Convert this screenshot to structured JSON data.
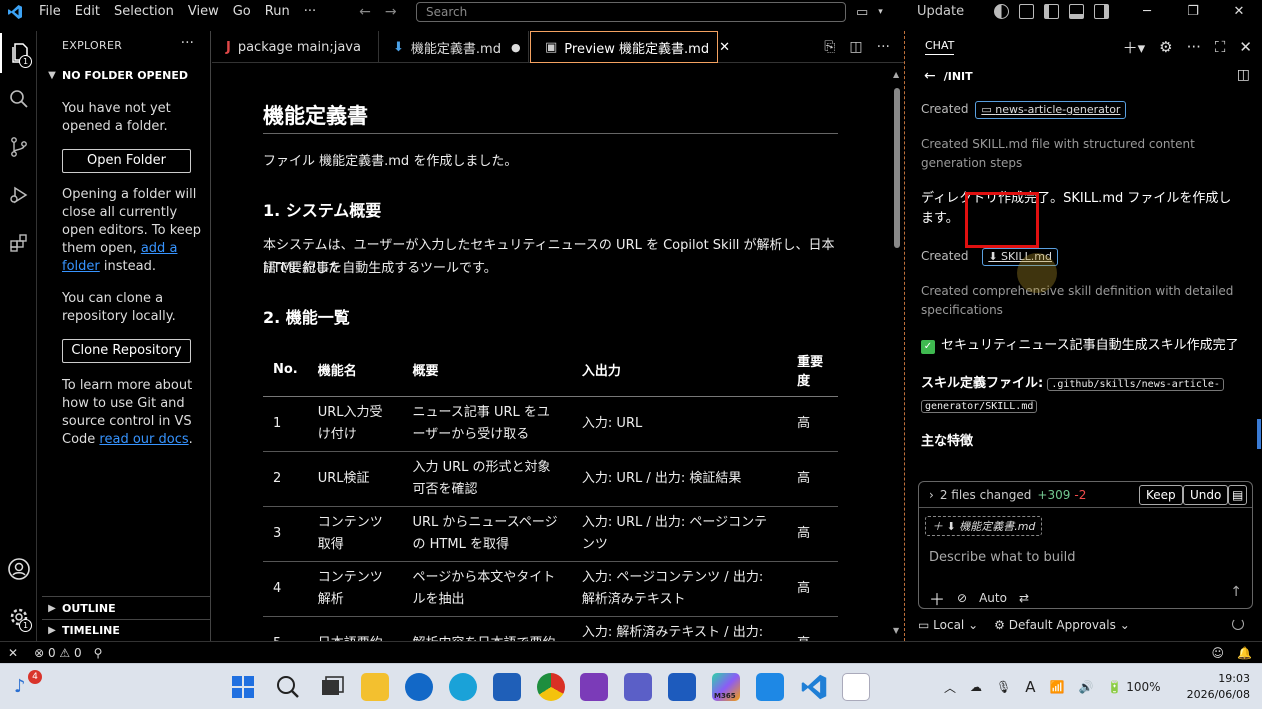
{
  "titlebar": {
    "menu": [
      "File",
      "Edit",
      "Selection",
      "View",
      "Go",
      "Run",
      "···"
    ],
    "search_placeholder": "Search",
    "update_label": "Update"
  },
  "sidebar": {
    "title": "EXPLORER",
    "section": "NO FOLDER OPENED",
    "msg1": "You have not yet opened a folder.",
    "open_folder": "Open Folder",
    "msg2_pre": "Opening a folder will close all currently open editors. To keep them open, ",
    "msg2_link": "add a folder",
    "msg2_post": " instead.",
    "msg3": "You can clone a repository locally.",
    "clone_repo": "Clone Repository",
    "msg4_pre": "To learn more about how to use Git and source control in VS Code ",
    "msg4_link": "read our docs",
    "msg4_post": ".",
    "outline": "OUTLINE",
    "timeline": "TIMELINE"
  },
  "tabs": [
    {
      "label": "package main;java",
      "icon": "J"
    },
    {
      "label": "機能定義書.md",
      "icon": "⬇",
      "dirty": "●"
    },
    {
      "label": "Preview 機能定義書.md",
      "icon": "▣",
      "close": "✕"
    }
  ],
  "doc": {
    "h1": "機能定義書",
    "intro": "ファイル 機能定義書.md を作成しました。",
    "h2_1": "1. システム概要",
    "p1_line1": "本システムは、ユーザーが入力したセキュリティニュースの URL を Copilot Skill が解析し、日本語で要約した",
    "p1_line2": "HTML 記事を自動生成するツールです。",
    "h2_2": "2. 機能一覧",
    "table_headers": [
      "No.",
      "機能名",
      "概要",
      "入出力",
      "重要度"
    ],
    "table_rows": [
      [
        "1",
        "URL入力受け付け",
        "ニュース記事 URL をユーザーから受け取る",
        "入力: URL",
        "高"
      ],
      [
        "2",
        "URL検証",
        "入力 URL の形式と対象可否を確認",
        "入力: URL / 出力: 検証結果",
        "高"
      ],
      [
        "3",
        "コンテンツ取得",
        "URL からニュースページの HTML を取得",
        "入力: URL / 出力: ページコンテンツ",
        "高"
      ],
      [
        "4",
        "コンテンツ解析",
        "ページから本文やタイトルを抽出",
        "入力: ページコンテンツ / 出力: 解析済みテキスト",
        "高"
      ],
      [
        "5",
        "日本語要約",
        "解析内容を日本語で要約",
        "入力: 解析済みテキスト / 出力: 日",
        "高"
      ]
    ]
  },
  "chat": {
    "tab": "CHAT",
    "sub_title": "/INIT",
    "created_label": "Created",
    "created_folder": "news-article-generator",
    "gray1": "Created SKILL.md file with structured content generation steps",
    "msg_dir": "ディレクトリ作成完了。SKILL.md ファイルを作成します。",
    "created_file": "SKILL.md",
    "gray2": "Created comprehensive skill definition with detailed specifications",
    "done_msg": "セキュリティニュース記事自動生成スキル作成完了",
    "skill_file_label": "スキル定義ファイル:",
    "skill_path_1": ".github/skills/news-article-",
    "skill_path_2": "generator/SKILL.md",
    "features": "主な特徴",
    "files_changed": "2 files changed",
    "added": "+309",
    "removed": "-2",
    "keep": "Keep",
    "undo": "Undo",
    "attached_file": "機能定義書.md",
    "prompt_placeholder": "Describe what to build",
    "mode": "Auto",
    "location": "Local",
    "approvals": "Default Approvals"
  },
  "statusbar": {
    "errors": "0",
    "warnings": "0"
  },
  "taskbar": {
    "badge": "4",
    "battery": "100%",
    "time": "19:03",
    "date": "2026/06/08",
    "m365": "M365"
  }
}
